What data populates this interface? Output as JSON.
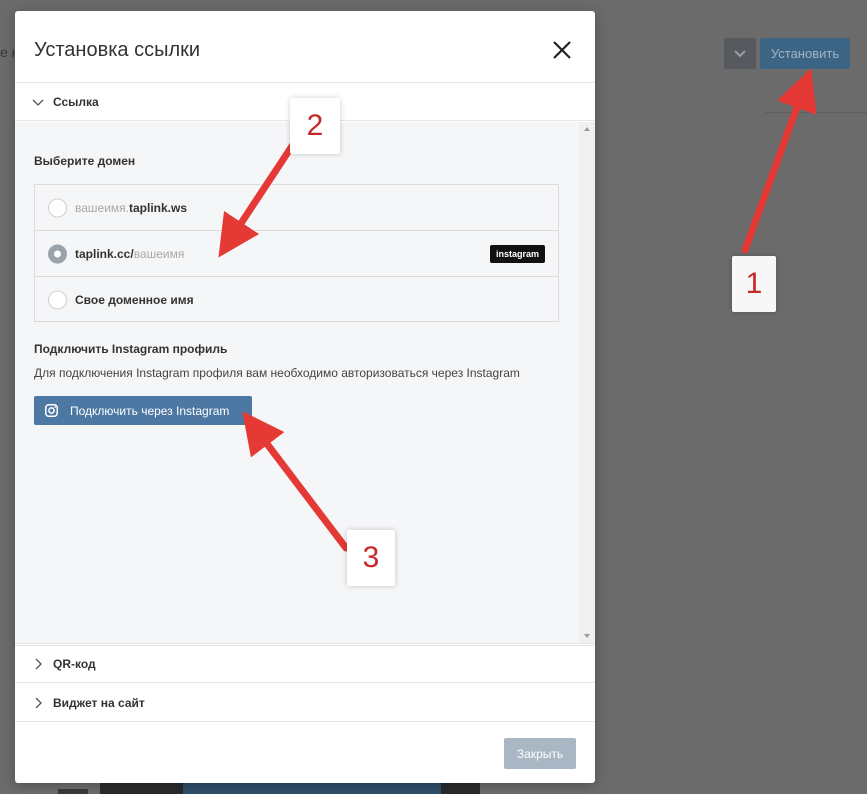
{
  "background": {
    "partial_text": "е к",
    "install_button": "Установить"
  },
  "modal": {
    "title": "Установка ссылки",
    "sections": {
      "link": "Ссылка",
      "qr": "QR-код",
      "widget": "Виджет на сайт"
    },
    "domain": {
      "label": "Выберите домен",
      "options": [
        {
          "prefix": "вашеимя.",
          "main": "taplink.ws",
          "suffix": "",
          "selected": false
        },
        {
          "prefix": "",
          "main": "taplink.cc/",
          "suffix": "вашеимя",
          "selected": true,
          "badge": "instagram"
        },
        {
          "prefix": "",
          "main": "Свое доменное имя",
          "suffix": "",
          "selected": false
        }
      ]
    },
    "instagram": {
      "title": "Подключить Instagram профиль",
      "description": "Для подключения Instagram профиля вам необходимо авторизоваться через Instagram",
      "button": "Подключить через Instagram"
    },
    "close_button": "Закрыть"
  },
  "annotations": [
    "1",
    "2",
    "3"
  ],
  "colors": {
    "arrow": "#e53935",
    "primary_button": "#4d78a4",
    "disabled_button": "#a9b6c3",
    "overlay": "#6b6b6b"
  }
}
